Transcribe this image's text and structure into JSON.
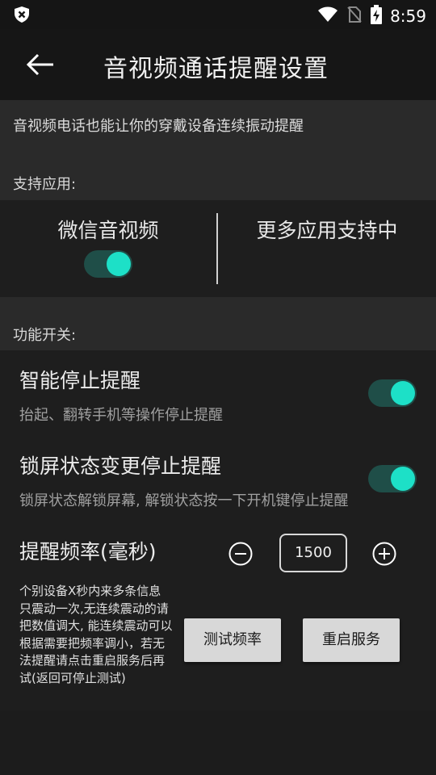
{
  "status_bar": {
    "time": "8:59",
    "icons": [
      "shield-x-icon",
      "wifi-icon",
      "no-sim-icon",
      "battery-charging-icon"
    ]
  },
  "app_bar": {
    "title": "音视频通话提醒设置",
    "back_icon": "arrow-left-icon"
  },
  "description": "音视频电话也能让你的穿戴设备连续振动提醒",
  "support_section": {
    "label": "支持应用:",
    "apps": [
      {
        "label": "微信音视频",
        "enabled": true
      },
      {
        "label": "更多应用支持中"
      }
    ]
  },
  "function_section": {
    "label": "功能开关:",
    "settings": [
      {
        "title": "智能停止提醒",
        "subtitle": "抬起、翻转手机等操作停止提醒",
        "enabled": true
      },
      {
        "title": "锁屏状态变更停止提醒",
        "subtitle": "锁屏状态解锁屏幕, 解锁状态按一下开机键停止提醒",
        "enabled": true
      }
    ]
  },
  "frequency": {
    "label": "提醒频率(毫秒)",
    "value": "1500",
    "decrement_icon": "minus-circle-icon",
    "increment_icon": "plus-circle-icon"
  },
  "note": "个别设备X秒内来多条信息只震动一次,无连续震动的请把数值调大, 能连续震动可以根据需要把频率调小，若无法提醒请点击重启服务后再试(返回可停止测试)",
  "buttons": {
    "test_label": "测试频率",
    "restart_label": "重启服务"
  },
  "colors": {
    "accent": "#1de0c7",
    "toggle_track": "#1f4e48",
    "background": "#1c1c1c",
    "section_bg": "#2a2a2a"
  }
}
